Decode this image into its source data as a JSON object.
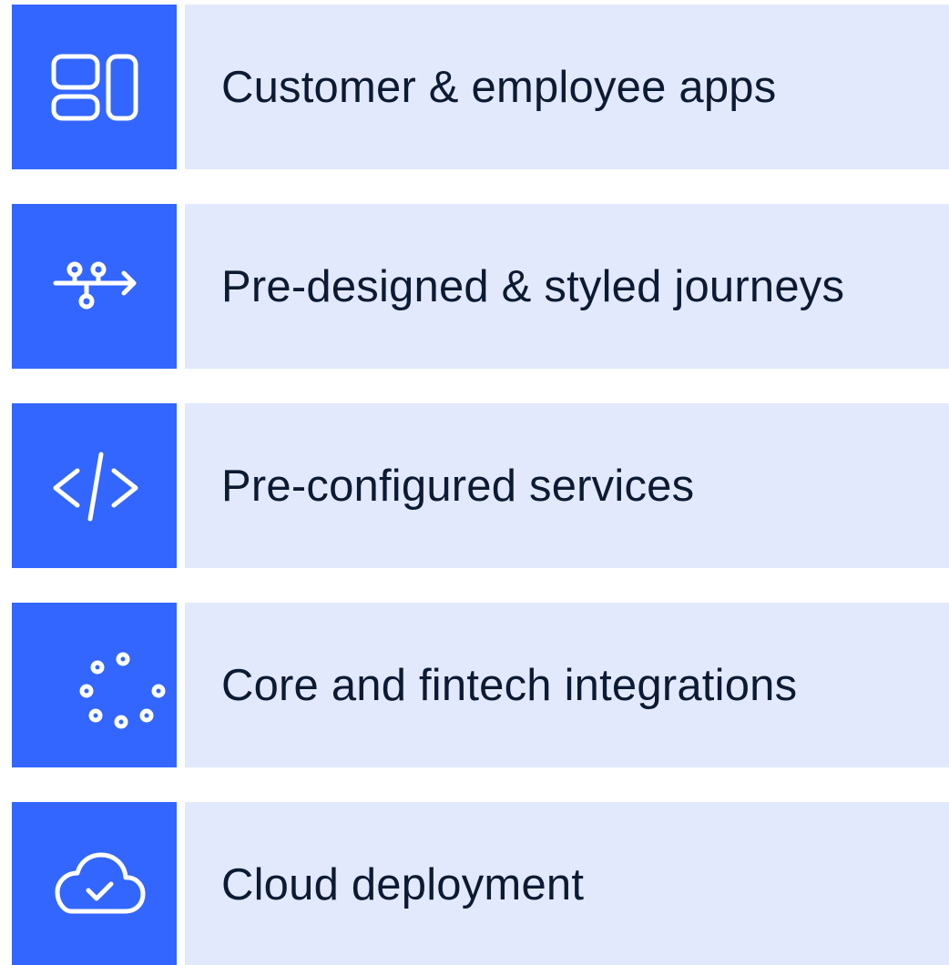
{
  "colors": {
    "icon_background": "#3366ff",
    "label_background": "#e2e9fc",
    "label_text": "#0c1a33",
    "icon_stroke": "#ffffff"
  },
  "features": [
    {
      "icon": "apps-layout-icon",
      "label": "Customer & employee apps"
    },
    {
      "icon": "journey-flow-icon",
      "label": "Pre-designed & styled journeys"
    },
    {
      "icon": "code-icon",
      "label": "Pre-configured services"
    },
    {
      "icon": "integrations-dots-icon",
      "label": "Core and fintech integrations"
    },
    {
      "icon": "cloud-check-icon",
      "label": "Cloud deployment"
    }
  ]
}
